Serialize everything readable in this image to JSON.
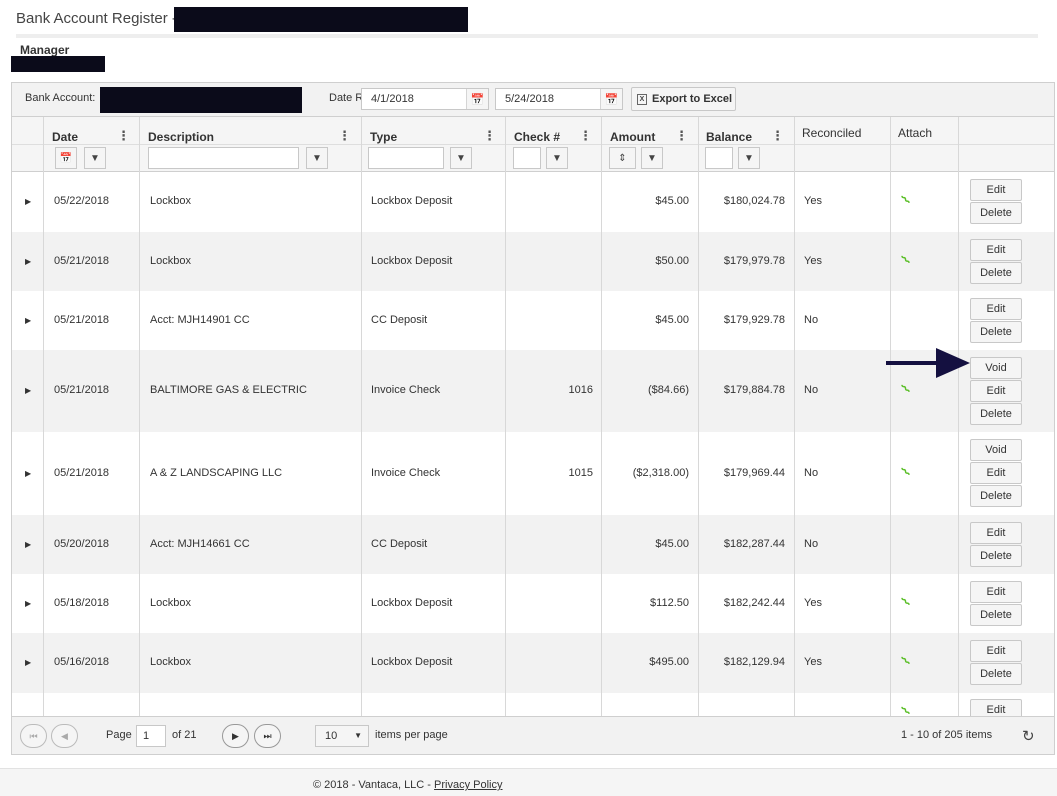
{
  "page": {
    "title": "Bank Account Register -",
    "subtitle": "Manager"
  },
  "toolbar": {
    "bank_account_label": "Bank Account:",
    "date_range_label": "Date Range",
    "start_date": "4/1/2018",
    "end_date": "5/24/2018",
    "export_label": "Export to Excel",
    "export_icon_glyph": "X"
  },
  "columns": {
    "date": "Date",
    "description": "Description",
    "type": "Type",
    "check": "Check #",
    "amount": "Amount",
    "balance": "Balance",
    "reconciled": "Reconciled",
    "attach": "Attach"
  },
  "rows": [
    {
      "date": "05/22/2018",
      "description": "Lockbox",
      "type": "Lockbox Deposit",
      "check": "",
      "amount": "$45.00",
      "balance": "$180,024.78",
      "reconciled": "Yes",
      "attach": true,
      "void": false
    },
    {
      "date": "05/21/2018",
      "description": "Lockbox",
      "type": "Lockbox Deposit",
      "check": "",
      "amount": "$50.00",
      "balance": "$179,979.78",
      "reconciled": "Yes",
      "attach": true,
      "void": false
    },
    {
      "date": "05/21/2018",
      "description": "Acct: MJH14901 CC",
      "type": "CC Deposit",
      "check": "",
      "amount": "$45.00",
      "balance": "$179,929.78",
      "reconciled": "No",
      "attach": false,
      "void": false
    },
    {
      "date": "05/21/2018",
      "description": "BALTIMORE GAS & ELECTRIC",
      "type": "Invoice Check",
      "check": "1016",
      "amount": "($84.66)",
      "balance": "$179,884.78",
      "reconciled": "No",
      "attach": true,
      "void": true
    },
    {
      "date": "05/21/2018",
      "description": "A & Z LANDSCAPING LLC",
      "type": "Invoice Check",
      "check": "1015",
      "amount": "($2,318.00)",
      "balance": "$179,969.44",
      "reconciled": "No",
      "attach": true,
      "void": true
    },
    {
      "date": "05/20/2018",
      "description": "Acct: MJH14661 CC",
      "type": "CC Deposit",
      "check": "",
      "amount": "$45.00",
      "balance": "$182,287.44",
      "reconciled": "No",
      "attach": false,
      "void": false
    },
    {
      "date": "05/18/2018",
      "description": "Lockbox",
      "type": "Lockbox Deposit",
      "check": "",
      "amount": "$112.50",
      "balance": "$182,242.44",
      "reconciled": "Yes",
      "attach": true,
      "void": false
    },
    {
      "date": "05/16/2018",
      "description": "Lockbox",
      "type": "Lockbox Deposit",
      "check": "",
      "amount": "$495.00",
      "balance": "$182,129.94",
      "reconciled": "Yes",
      "attach": true,
      "void": false
    },
    {
      "date": "",
      "description": "",
      "type": "",
      "check": "",
      "amount": "",
      "balance": "",
      "reconciled": "",
      "attach": true,
      "void": false
    }
  ],
  "actions": {
    "void": "Void",
    "edit": "Edit",
    "delete": "Delete"
  },
  "pager": {
    "page_label": "Page",
    "current_page": "1",
    "of_label": "of 21",
    "per_page_value": "10",
    "per_page_label": "items per page",
    "summary": "1 - 10 of 205 items"
  },
  "icons": {
    "first": "⏮",
    "prev": "◀",
    "next": "▶",
    "last": "⏭",
    "refresh": "↻",
    "calendar": "📅",
    "filter": "▼",
    "expand": "▶",
    "kebab": "⋮",
    "clip": "⌇",
    "caret": "▼",
    "sort": "⇕"
  },
  "colors": {
    "attach_icon": "#5cbf2a",
    "arrow": "#141040"
  },
  "footer": {
    "copyright": "© 2018 - Vantaca, LLC -",
    "privacy": "Privacy Policy"
  }
}
